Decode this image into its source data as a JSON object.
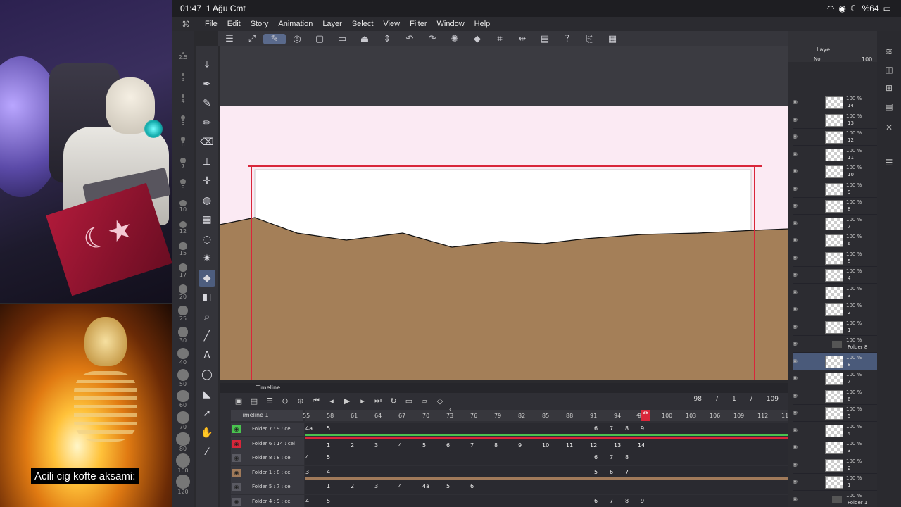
{
  "status": {
    "time": "01:47",
    "date": "1 Ağu Cmt",
    "battery": "%64"
  },
  "menu": [
    "File",
    "Edit",
    "Story",
    "Animation",
    "Layer",
    "Select",
    "View",
    "Filter",
    "Window",
    "Help"
  ],
  "toolbar_icons": [
    "menu-icon",
    "transform-icon",
    "pen-mode-icon",
    "onion-icon",
    "new-file-icon",
    "open-icon",
    "save-icon",
    "arrows-icon",
    "undo-icon",
    "redo-icon",
    "spinner-icon",
    "fill-icon",
    "crop-icon",
    "flip-icon",
    "page-icon",
    "help-icon",
    "export-icon",
    "grid-icon"
  ],
  "brush_sizes": [
    "2.5",
    "3",
    "4",
    "5",
    "6",
    "7",
    "8",
    "10",
    "12",
    "15",
    "17",
    "20",
    "25",
    "30",
    "40",
    "50",
    "60",
    "70",
    "80",
    "100",
    "120"
  ],
  "tools": [
    "download-icon",
    "pen-icon",
    "pencil-icon",
    "marker-icon",
    "eraser-icon",
    "stamp-icon",
    "move-icon",
    "blend-icon",
    "mesh-icon",
    "lasso-icon",
    "magic-wand-icon",
    "fill-icon",
    "gradient-icon",
    "eyedropper-icon",
    "line-icon",
    "text-icon",
    "balloon-icon",
    "pen-tool-icon",
    "operation-icon",
    "hand-icon",
    "picker-icon"
  ],
  "caption": "Acili cig kofte aksami:",
  "timeline": {
    "title": "Timeline",
    "name": "Timeline 1",
    "frame_current": "98",
    "sep1": "/",
    "frame_mid": "1",
    "sep2": "/",
    "frame_total": "109",
    "ruler": [
      "55",
      "58",
      "61",
      "64",
      "67",
      "70",
      "73",
      "76",
      "79",
      "82",
      "85",
      "88",
      "91",
      "94",
      "97",
      "100",
      "103",
      "106",
      "109",
      "112",
      "115"
    ],
    "ruler_mark": "3",
    "marker_labels": [
      "4",
      "98"
    ],
    "tracks": [
      {
        "name": "Folder 7 : 9 : cel",
        "cels": [
          "4a",
          "5",
          "6",
          "7",
          "8",
          "9"
        ]
      },
      {
        "name": "Folder 6 : 14 : cel",
        "cels": [
          "1",
          "2",
          "3",
          "4",
          "5",
          "6",
          "7",
          "8",
          "9",
          "10",
          "11",
          "12",
          "13",
          "14"
        ]
      },
      {
        "name": "Folder 8 : 8 : cel",
        "cels": [
          "4",
          "5",
          "6",
          "7",
          "8"
        ]
      },
      {
        "name": "Folder 1 : 8 : cel",
        "cels": [
          "3",
          "4",
          "5",
          "6",
          "7"
        ]
      },
      {
        "name": "Folder 5 : 7 : cel",
        "cels": [
          "1",
          "2",
          "3",
          "4",
          "4a",
          "5",
          "6"
        ]
      },
      {
        "name": "Folder 4 : 9 : cel",
        "cels": [
          "4",
          "5",
          "6",
          "7",
          "8",
          "9"
        ]
      }
    ]
  },
  "layers": {
    "header_tab": "Laye",
    "blend": "Nor",
    "opacity": "100",
    "rows": [
      {
        "pct": "100 %",
        "name": "14"
      },
      {
        "pct": "100 %",
        "name": "13"
      },
      {
        "pct": "100 %",
        "name": "12"
      },
      {
        "pct": "100 %",
        "name": "11"
      },
      {
        "pct": "100 %",
        "name": "10"
      },
      {
        "pct": "100 %",
        "name": "9"
      },
      {
        "pct": "100 %",
        "name": "8"
      },
      {
        "pct": "100 %",
        "name": "7"
      },
      {
        "pct": "100 %",
        "name": "6"
      },
      {
        "pct": "100 %",
        "name": "5"
      },
      {
        "pct": "100 %",
        "name": "4"
      },
      {
        "pct": "100 %",
        "name": "3"
      },
      {
        "pct": "100 %",
        "name": "2"
      },
      {
        "pct": "100 %",
        "name": "1"
      },
      {
        "pct": "100 %",
        "name": "Folder 8",
        "folder": true
      },
      {
        "pct": "100 %",
        "name": "8",
        "selected": true
      },
      {
        "pct": "100 %",
        "name": "7"
      },
      {
        "pct": "100 %",
        "name": "6"
      },
      {
        "pct": "100 %",
        "name": "5"
      },
      {
        "pct": "100 %",
        "name": "4"
      },
      {
        "pct": "100 %",
        "name": "3"
      },
      {
        "pct": "100 %",
        "name": "2"
      },
      {
        "pct": "100 %",
        "name": "1"
      },
      {
        "pct": "100 %",
        "name": "Folder 1",
        "folder": true
      }
    ]
  },
  "colors": {
    "ground": "#a47f58",
    "accent_red": "#d9263a",
    "accent_green": "#49c34f"
  }
}
